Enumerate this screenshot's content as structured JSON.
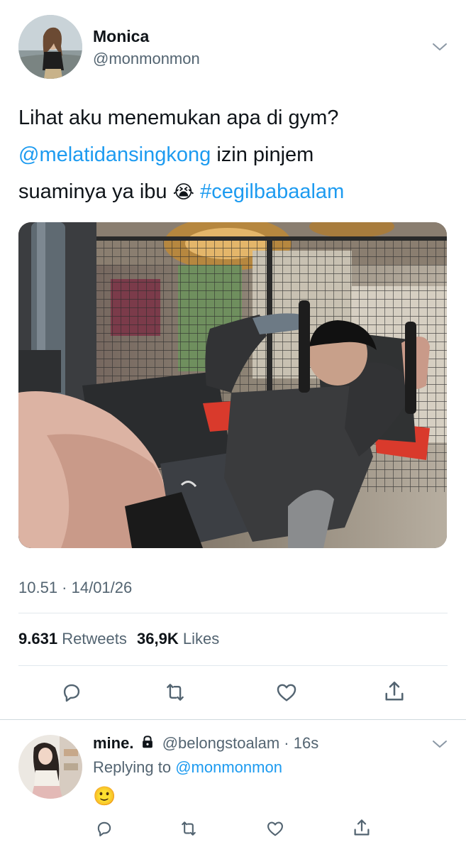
{
  "tweet": {
    "author": {
      "name": "Monica",
      "handle": "@monmonmon"
    },
    "text": {
      "line1": "Lihat aku menemukan apa di gym?",
      "mention": "@melatidansingkong",
      "line2_rest": " izin pinjem",
      "line3_start": "suaminya ya ibu ",
      "emoji": "😭",
      "hashtag": "#cegilbabaalam"
    },
    "timestamp": "10.51 · 14/01/26",
    "stats": {
      "retweets_count": "9.631",
      "retweets_label": "Retweets",
      "likes_count": "36,9K",
      "likes_label": "Likes"
    }
  },
  "reply": {
    "name": "mine.",
    "handle": "@belongstoalam",
    "time": "· 16s",
    "replying_prefix": "Replying to",
    "replying_handle": "@monmonmon",
    "content_emoji": "🙂"
  },
  "icons": {
    "reply": "reply-icon",
    "retweet": "retweet-icon",
    "like": "heart-icon",
    "share": "share-icon",
    "lock": "lock-icon",
    "more": "chevron-down-icon"
  },
  "colors": {
    "accent": "#1d9bf0",
    "text": "#0f1419",
    "muted": "#536471",
    "divider": "#e1e8ed"
  }
}
